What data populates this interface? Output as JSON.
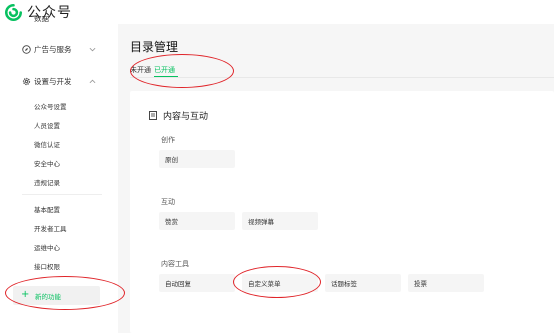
{
  "app": {
    "name": "公众号",
    "brand_color": "#07c160"
  },
  "sidebar": {
    "top_partial": "数据",
    "sections": [
      {
        "label": "广告与服务",
        "icon": "compass-icon",
        "expanded": false
      },
      {
        "label": "设置与开发",
        "icon": "gear-icon",
        "expanded": true
      }
    ],
    "settings_items": [
      "公众号设置",
      "人员设置",
      "微信认证",
      "安全中心",
      "违规记录"
    ],
    "dev_items": [
      "基本配置",
      "开发者工具",
      "运维中心",
      "接口权限"
    ],
    "new_function": "新的功能"
  },
  "main": {
    "title": "目录管理",
    "tabs": [
      {
        "label": "未开通",
        "active": false
      },
      {
        "label": "已开通",
        "active": true
      }
    ],
    "card": {
      "title": "内容与互动",
      "groups": [
        {
          "label": "创作",
          "items": [
            "原创"
          ]
        },
        {
          "label": "互动",
          "items": [
            "赞赏",
            "视频弹幕"
          ]
        },
        {
          "label": "内容工具",
          "items": [
            "自动回复",
            "自定义菜单",
            "话题标签",
            "投票"
          ]
        }
      ]
    }
  },
  "annotations": {
    "color": "#e0252a"
  }
}
